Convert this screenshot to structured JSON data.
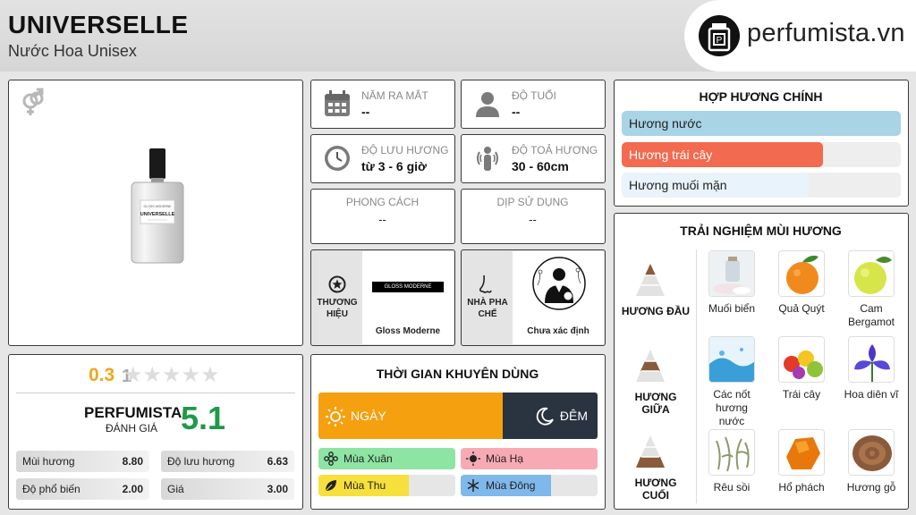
{
  "header": {
    "title": "UNIVERSELLE",
    "subtitle": "Nước Hoa Unisex",
    "logo_text": "perfumista.vn"
  },
  "product": {
    "bottle_label": "UNIVERSELLE",
    "bottle_brand": "GLOSS MODERNE",
    "gender_icon": "gender-unisex-icon"
  },
  "info": {
    "launch": {
      "label": "NĂM RA MẮT",
      "value": "--"
    },
    "age": {
      "label": "ĐỘ TUỔI",
      "value": "--"
    },
    "longevity": {
      "label": "ĐỘ LƯU HƯƠNG",
      "value": "từ 3 - 6 giờ"
    },
    "sillage": {
      "label": "ĐỘ TOẢ HƯƠNG",
      "value": "30 - 60cm"
    },
    "style": {
      "label": "PHONG CÁCH",
      "value": "--"
    },
    "occasion": {
      "label": "DỊP SỬ DỤNG",
      "value": "--"
    },
    "brand": {
      "label1": "THƯƠNG",
      "label2": "HIỆU",
      "logo_text": "GLOSS MODERNE",
      "name": "Gloss Moderne"
    },
    "perfumer": {
      "label1": "NHÀ PHA",
      "label2": "CHẾ",
      "name": "Chưa xác định"
    }
  },
  "rating": {
    "user_score": "0.3",
    "user_trail": "1",
    "stars_filled_fraction": 0.06,
    "brand": "PERFUMISTA",
    "brand_sub": "ĐÁNH GIÁ",
    "score": "5.1",
    "stats": [
      {
        "label": "Mùi hương",
        "value": "8.80"
      },
      {
        "label": "Độ lưu hương",
        "value": "6.63"
      },
      {
        "label": "Độ phổ biến",
        "value": "2.00"
      },
      {
        "label": "Giá",
        "value": "3.00"
      }
    ]
  },
  "accords": {
    "title": "HỢP HƯƠNG CHÍNH",
    "items": [
      {
        "label": "Hương nước",
        "level": 1.0,
        "color": "#a8d4e6"
      },
      {
        "label": "Hương trái cây",
        "level": 0.72,
        "color": "#f26a4f"
      },
      {
        "label": "Hương muối mặn",
        "level": 0.67,
        "color": "#e8f3fb"
      }
    ]
  },
  "usage": {
    "title": "THỜI GIAN KHUYÊN DÙNG",
    "day": "NGÀY",
    "night": "ĐÊM",
    "day_fraction": 0.66,
    "day_color": "#f5a00f",
    "night_color": "#2a3340",
    "seasons": [
      {
        "label": "Mùa Xuân",
        "level": 1.0,
        "color": "#8ee4a2",
        "icon": "spring-flower-icon"
      },
      {
        "label": "Mùa Hạ",
        "level": 1.0,
        "color": "#f7aab4",
        "icon": "summer-sun-icon"
      },
      {
        "label": "Mùa Thu",
        "level": 0.66,
        "color": "#f7e03c",
        "icon": "autumn-leaf-icon"
      },
      {
        "label": "Mùa Đông",
        "level": 0.66,
        "color": "#7fb8ea",
        "icon": "winter-snowflake-icon"
      }
    ]
  },
  "notes": {
    "title": "TRẢI NGHIỆM MÙI HƯƠNG",
    "tiers": [
      {
        "label": "HƯƠNG ĐẦU",
        "items": [
          {
            "name": "Muối biển",
            "icon": "sea-salt-icon"
          },
          {
            "name": "Quả Quýt",
            "icon": "mandarin-icon"
          },
          {
            "name": "Cam Bergamot",
            "icon": "bergamot-icon"
          }
        ]
      },
      {
        "label": "HƯƠNG GIỮA",
        "items": [
          {
            "name": "Các nốt hương nước",
            "icon": "water-notes-icon"
          },
          {
            "name": "Trái cây",
            "icon": "fruits-icon"
          },
          {
            "name": "Hoa diên vĩ",
            "icon": "iris-icon"
          }
        ]
      },
      {
        "label": "HƯƠNG CUỐI",
        "items": [
          {
            "name": "Rêu sồi",
            "icon": "oakmoss-icon"
          },
          {
            "name": "Hổ phách",
            "icon": "amber-icon"
          },
          {
            "name": "Hương gỗ",
            "icon": "wood-icon"
          }
        ]
      }
    ]
  }
}
